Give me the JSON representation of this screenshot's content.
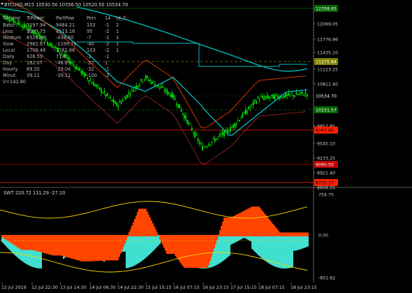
{
  "title": "BTCUSD,M15  10530.50 10556.50 10520.50 10534.70",
  "table": {
    "header": [
      "TrName",
      "TrPower",
      "PartPow",
      "Perc",
      "14",
      "td_0"
    ],
    "rows": [
      [
        "Basic",
        "5197.94",
        "9484.21",
        "103",
        "-1",
        "2"
      ],
      [
        "Less",
        "9007.75",
        "8513.16",
        "95",
        "-2",
        "1"
      ],
      [
        "Medium",
        "6528.83",
        "-434.60",
        "-7",
        "-1",
        "1"
      ],
      [
        "Slow",
        "2962.67",
        "-1199.70",
        "-40",
        "-2",
        "1"
      ],
      [
        "Local",
        "1708.48",
        "1782.66",
        "103",
        "-2",
        "1"
      ],
      [
        "Daily",
        "926.59",
        "71.6",
        "-1",
        "-1",
        ""
      ],
      [
        "Day",
        "182.07",
        "-48.65",
        "-27",
        "1",
        ""
      ],
      [
        "Hourly",
        "89.20",
        "-29.04",
        "-32",
        "-1",
        ""
      ],
      [
        "Minut",
        "39.11",
        "-39.11",
        "-100",
        "-2",
        ""
      ]
    ],
    "volume": "V=142.80"
  },
  "price_axis": {
    "ticks": [
      "12358.65",
      "12069.05",
      "11776.96",
      "11435.10",
      "11123.25",
      "10811.40",
      "10534.70",
      "10251.57",
      "9857.85",
      "9545.10",
      "9233.25",
      "8921.40",
      "8609.55"
    ],
    "tags": [
      {
        "label": "12358.65",
        "color": "#006400",
        "text_color": "#ffffff"
      },
      {
        "label": "11275.84",
        "color": "#808000",
        "text_color": "#ffffff"
      },
      {
        "label": "10534.70",
        "color": "#000000",
        "text_color": "#ffffff"
      },
      {
        "label": "10251.57",
        "color": "#006400",
        "text_color": "#ffffff"
      },
      {
        "label": "9767.85",
        "color": "#ff2000",
        "text_color": "#000000"
      },
      {
        "label": "9090.50",
        "color": "#c00000",
        "text_color": "#ffffff"
      },
      {
        "label": "8733.17",
        "color": "#ff2000",
        "text_color": "#000000"
      }
    ]
  },
  "indicator": {
    "title": "SWT 220.72 111.29 -27.10",
    "axis": [
      "754.75",
      "0.00",
      "-851.62"
    ]
  },
  "time_axis": [
    "12 Jul 2019",
    "12 Jul 22:30",
    "13 Jul 14:30",
    "14 Jul 06:30",
    "14 Jul 22:30",
    "15 Jul 15:15",
    "16 Jul 07:15",
    "16 Jul 23:15",
    "17 Jul 15:15",
    "18 Jul 07:15",
    "18 Jul 23:15"
  ],
  "colors": {
    "background": "#000000",
    "candles": "#00ff00",
    "ma_cyan": "#00c0c0",
    "upper_band": "#ff4500",
    "lower_band": "#a52a2a",
    "osc_fill": "#ff4500",
    "osc_cyan": "#40e0d0",
    "osc_yellow": "#ffd700"
  },
  "chart_data": {
    "type": "line",
    "title": "BTCUSD,M15",
    "x": [
      "12 Jul 2019",
      "12 Jul 22:30",
      "13 Jul 14:30",
      "14 Jul 06:30",
      "14 Jul 22:30",
      "15 Jul 15:15",
      "16 Jul 07:15",
      "16 Jul 23:15",
      "17 Jul 15:15",
      "18 Jul 07:15",
      "18 Jul 23:15"
    ],
    "series": [
      {
        "values": [
          12300,
          11950,
          11500,
          10900,
          10350,
          10950,
          10550,
          9450,
          9850,
          10500,
          10600
        ]
      }
    ],
    "ylim": [
      8609.55,
      12500
    ],
    "grid": false,
    "last_price": 10534.7,
    "levels": [
      12358.65,
      11275.84,
      10251.57,
      9767.85,
      9090.5,
      8733.17
    ]
  }
}
